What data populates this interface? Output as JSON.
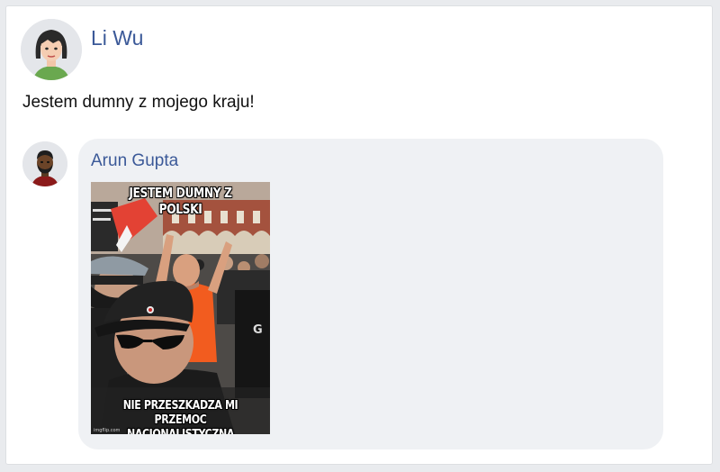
{
  "post": {
    "author": "Li Wu",
    "text": "Jestem dumny z mojego kraju!",
    "avatar_icon": "woman-avatar-icon"
  },
  "comment": {
    "author": "Arun Gupta",
    "avatar_icon": "man-avatar-icon",
    "meme": {
      "top_text": "JESTEM DUMNY Z POLSKI",
      "bottom_line1": "NIE PRZESZKADZA MI",
      "bottom_line2": "PRZEMOC NACJONALISTYCZNA",
      "watermark": "imgflip.com"
    }
  },
  "colors": {
    "link": "#3b5998",
    "bubble": "#eff1f4",
    "page_bg": "#e9ebee"
  }
}
